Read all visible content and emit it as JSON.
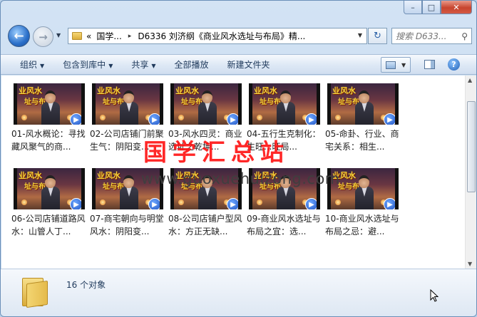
{
  "window": {
    "buttons": {
      "minimize": "–",
      "maximize": "□",
      "close": "✕"
    }
  },
  "nav": {
    "back_icon": "back-arrow-icon",
    "forward_icon": "forward-arrow-icon",
    "address": {
      "overflow": "«",
      "crumb1": "国学...",
      "separator": "▸",
      "crumb2": "D6336 刘济纲《商业风水选址与布局》精..."
    },
    "search_placeholder": "搜索 D633..."
  },
  "toolbar": {
    "organize": "组织",
    "include_in_library": "包含到库中",
    "share": "共享",
    "play_all": "全部播放",
    "new_folder": "新建文件夹"
  },
  "thumb": {
    "title": "业风水",
    "subtitle": "址与布局"
  },
  "files": [
    {
      "label": "01-风水概论：寻找藏风聚气的商..."
    },
    {
      "label": "02-公司店铺门前聚生气：阴阳变..."
    },
    {
      "label": "03-风水四灵：商业选址之乾坤..."
    },
    {
      "label": "04-五行生克制化：生旺...旺局..."
    },
    {
      "label": "05-命卦、行业、商宅关系：相生..."
    },
    {
      "label": "06-公司店铺道路风水：山管人丁..."
    },
    {
      "label": "07-商宅朝向与明堂风水：阴阳变..."
    },
    {
      "label": "08-公司店铺户型风水：方正无缺..."
    },
    {
      "label": "09-商业风水选址与布局之宜：选..."
    },
    {
      "label": "10-商业风水选址与布局之忌：避..."
    }
  ],
  "watermark": {
    "cn": "国学汇总站",
    "url": "www.guoxuehuizong.com"
  },
  "status": {
    "count": "16 个对象"
  }
}
